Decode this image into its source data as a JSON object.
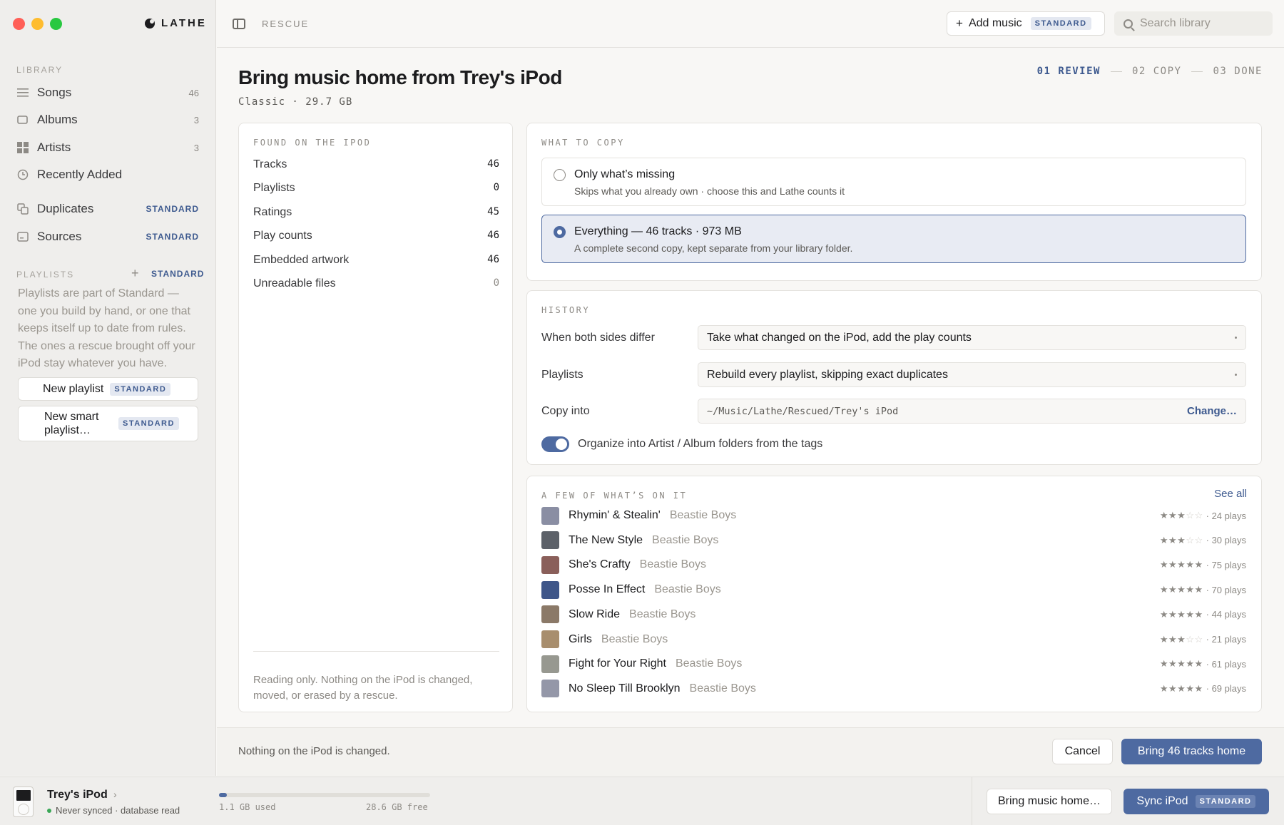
{
  "app": {
    "name": "LATHE",
    "crumb": "RESCUE"
  },
  "colors": {
    "accent": "#4e6aa1",
    "link": "#3e5a8f",
    "traffic_close": "#ff5f57",
    "traffic_min": "#febc2e",
    "traffic_max": "#28c840",
    "synced_dot": "#3aa757"
  },
  "topbar": {
    "add_music": "Add music",
    "add_badge": "STANDARD",
    "search_placeholder": "Search library"
  },
  "sidebar": {
    "library_label": "LIBRARY",
    "items": [
      {
        "label": "Songs",
        "count": "46",
        "icon": "list-icon"
      },
      {
        "label": "Albums",
        "count": "3",
        "icon": "album-icon"
      },
      {
        "label": "Artists",
        "count": "3",
        "icon": "grid-icon"
      },
      {
        "label": "Recently Added",
        "count": "",
        "icon": "clock-icon"
      },
      {
        "label": "Duplicates",
        "count": "STANDARD",
        "icon": "duplicate-icon"
      },
      {
        "label": "Sources",
        "count": "STANDARD",
        "icon": "drive-icon"
      }
    ],
    "playlists_label": "PLAYLISTS",
    "playlists_badge": "STANDARD",
    "playlists_desc": "Playlists are part of Standard — one you build by hand, or one that keeps itself up to date from rules. The ones a rescue brought off your iPod stay whatever you have.",
    "new_playlist": "New playlist",
    "new_smart_playlist": "New smart playlist…",
    "std_badge": "STANDARD"
  },
  "main": {
    "title": "Bring music home from Trey's iPod",
    "subtitle": "Classic · 29.7 GB",
    "steps": [
      "01 REVIEW",
      "02 COPY",
      "03 DONE"
    ],
    "active_step": 0
  },
  "found": {
    "label": "FOUND ON THE IPOD",
    "rows": [
      {
        "k": "Tracks",
        "v": "46"
      },
      {
        "k": "Playlists",
        "v": "0"
      },
      {
        "k": "Ratings",
        "v": "45"
      },
      {
        "k": "Play counts",
        "v": "46"
      },
      {
        "k": "Embedded artwork",
        "v": "46"
      },
      {
        "k": "Unreadable files",
        "v": "0"
      }
    ],
    "note": "Reading only. Nothing on the iPod is changed, moved, or erased by a rescue."
  },
  "what": {
    "label": "WHAT TO COPY",
    "options": [
      {
        "title": "Only what’s missing",
        "desc": "Skips what you already own · choose this and Lathe counts it",
        "selected": false
      },
      {
        "title": "Everything — 46 tracks · 973 MB",
        "desc": "A complete second copy, kept separate from your library folder.",
        "selected": true
      }
    ]
  },
  "history": {
    "label": "HISTORY",
    "differ_label": "When both sides differ",
    "differ_value": "Take what changed on the iPod, add the play counts",
    "playlists_label": "Playlists",
    "playlists_value": "Rebuild every playlist, skipping exact duplicates",
    "copy_label": "Copy into",
    "copy_path": "~/Music/Lathe/Rescued/Trey's iPod",
    "change": "Change…",
    "organize_label": "Organize into Artist / Album folders from the tags",
    "organize_on": true
  },
  "few": {
    "label": "A FEW OF WHAT’S ON IT",
    "see_all": "See all",
    "tracks": [
      {
        "title": "Rhymin' & Stealin'",
        "artist": "Beastie Boys",
        "rating": 3,
        "plays": "· 24 plays",
        "color": "#8a8ea3"
      },
      {
        "title": "The New Style",
        "artist": "Beastie Boys",
        "rating": 3,
        "plays": "· 30 plays",
        "color": "#5c6169"
      },
      {
        "title": "She's Crafty",
        "artist": "Beastie Boys",
        "rating": 5,
        "plays": "· 75 plays",
        "color": "#8a5f5a"
      },
      {
        "title": "Posse In Effect",
        "artist": "Beastie Boys",
        "rating": 5,
        "plays": "· 70 plays",
        "color": "#3f5689"
      },
      {
        "title": "Slow Ride",
        "artist": "Beastie Boys",
        "rating": 5,
        "plays": "· 44 plays",
        "color": "#8b7968"
      },
      {
        "title": "Girls",
        "artist": "Beastie Boys",
        "rating": 3,
        "plays": "· 21 plays",
        "color": "#a88e6d"
      },
      {
        "title": "Fight for Your Right",
        "artist": "Beastie Boys",
        "rating": 5,
        "plays": "· 61 plays",
        "color": "#979890"
      },
      {
        "title": "No Sleep Till Brooklyn",
        "artist": "Beastie Boys",
        "rating": 5,
        "plays": "· 69 plays",
        "color": "#9497a8"
      }
    ]
  },
  "footer": {
    "note": "Nothing on the iPod is changed.",
    "cancel": "Cancel",
    "primary": "Bring 46 tracks home"
  },
  "device": {
    "name": "Trey's iPod",
    "status": "Never synced · database read",
    "used": "1.1 GB used",
    "free": "28.6 GB free",
    "used_fraction": 0.037,
    "bring_home": "Bring music home…",
    "sync": "Sync iPod",
    "sync_badge": "STANDARD"
  }
}
